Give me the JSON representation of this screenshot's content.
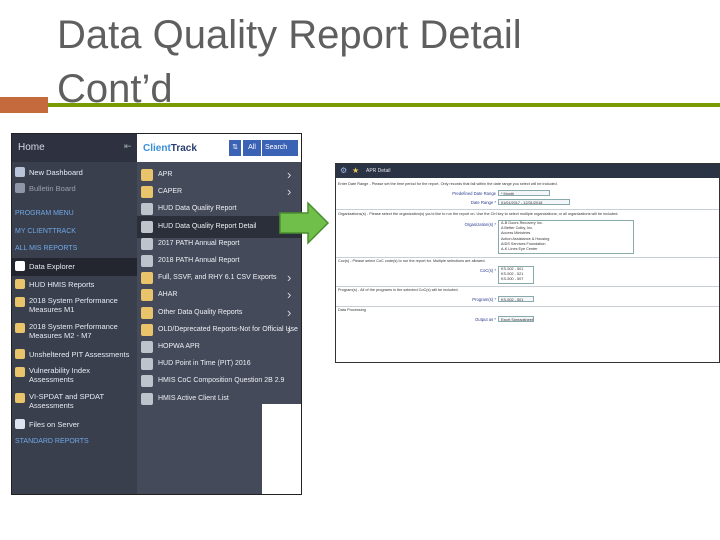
{
  "slide": {
    "title_line1": "Data Quality Report Detail",
    "title_line2": "Cont’d",
    "accent_line_color": "#7a9a01",
    "accent_square_color": "#c56a3c"
  },
  "sidebar": {
    "home_label": "Home",
    "items": [
      {
        "label": "New Dashboard",
        "icon": "dashboard-icon"
      },
      {
        "label": "Bulletin Board",
        "icon": "bulletin-icon"
      }
    ],
    "sections": [
      "PROGRAM MENU",
      "MY CLIENTTRACK",
      "ALL MIS REPORTS"
    ],
    "report_items": [
      {
        "label": "Data Explorer",
        "icon": "info-icon",
        "selected": true
      },
      {
        "label": "HUD HMIS Reports",
        "icon": "folder-icon"
      },
      {
        "label": "2018 System Performance Measures M1",
        "icon": "folder-icon"
      },
      {
        "label": "2018 System Performance Measures M2 - M7",
        "icon": "folder-icon"
      },
      {
        "label": "Unsheltered PIT Assessments",
        "icon": "folder-icon"
      },
      {
        "label": "Vulnerability Index Assessments",
        "icon": "folder-icon"
      },
      {
        "label": "VI-SPDAT and SPDAT Assessments",
        "icon": "folder-icon"
      },
      {
        "label": "Files on Server",
        "icon": "check-icon"
      }
    ],
    "footer_section": "STANDARD REPORTS"
  },
  "clienttrack": {
    "logo_prefix": "Client",
    "logo_suffix": "Track",
    "all_label": "All",
    "search_label": "Search"
  },
  "menu": {
    "items": [
      {
        "label": "APR",
        "type": "folder",
        "arrow": true
      },
      {
        "label": "CAPER",
        "type": "folder",
        "arrow": true
      },
      {
        "label": "HUD Data Quality Report",
        "type": "doc",
        "arrow": false
      },
      {
        "label": "HUD Data Quality Report Detail",
        "type": "doc",
        "arrow": false,
        "highlight": true
      },
      {
        "label": "2017 PATH Annual Report",
        "type": "doc",
        "arrow": false
      },
      {
        "label": "2018 PATH Annual Report",
        "type": "doc",
        "arrow": false
      },
      {
        "label": "Full, SSVF, and RHY 6.1 CSV Exports",
        "type": "folder",
        "arrow": true
      },
      {
        "label": "AHAR",
        "type": "folder",
        "arrow": true
      },
      {
        "label": "Other Data Quality Reports",
        "type": "folder",
        "arrow": true
      },
      {
        "label": "OLD/Deprecated Reports-Not for Official Use",
        "type": "folder",
        "arrow": true
      },
      {
        "label": "HOPWA APR",
        "type": "doc",
        "arrow": false
      },
      {
        "label": "HUD Point in Time (PIT) 2016",
        "type": "doc",
        "arrow": false
      },
      {
        "label": "HMIS CoC Composition Question 2B 2.9",
        "type": "doc",
        "arrow": false
      },
      {
        "label": "HMIS Active Client List",
        "type": "doc",
        "arrow": false
      }
    ]
  },
  "report": {
    "window_title": "APR Detail",
    "intro_text": "Enter Date Range - Please set the time period for the report. Only records that fall within the date range you select will be included.",
    "date_range_label": "Predefined Date Range",
    "date_range_value": "* Month",
    "range_label": "Date Range *",
    "range_value": "01/01/2017 - 12/31/2018",
    "org_text": "Organizations(s) - Please select the organization(s) you'd like to run the report on. Use the Ctrl key to select multiple organizations; or all organizations will be included.",
    "org_label": "Organization(s) *",
    "org_options": [
      "A-B Doors Recovery Inc.",
      "A Better Colby, Inc.",
      "Access Ministries",
      "Action Assistance & Housing",
      "AIDS Services Foundation",
      "A-K Lines Eye Center"
    ],
    "coc_text": "Coc(s) - Please select CoC code(s) to run the report for. Multiple selections are allowed.",
    "coc_label": "CoC(s) *",
    "coc_options": [
      "KS-502 - 501",
      "KS-502 - 521",
      "KS-500 - 507"
    ],
    "program_text": "Program(s) - All of the programs in the selected CoC(s) will be included.",
    "program_label": "Program(s) *",
    "program_value": "KS-502 - 501",
    "processing_text": "Data Processing",
    "output_label": "Output as *",
    "output_value": "Excel Spreadsheet"
  }
}
